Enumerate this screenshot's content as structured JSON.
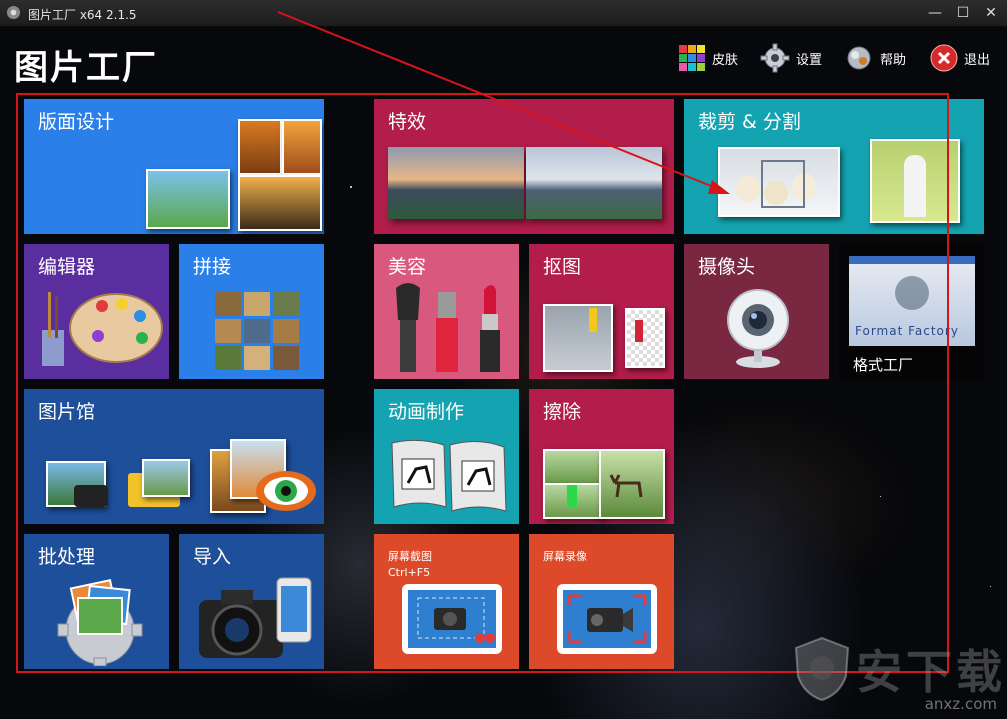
{
  "window": {
    "title": "图片工厂 x64 2.1.5",
    "minimize": "—",
    "maximize": "☐",
    "close": "✕"
  },
  "header": {
    "app_title": "图片工厂",
    "buttons": [
      {
        "label": "皮肤",
        "icon": "palette-grid-icon"
      },
      {
        "label": "设置",
        "icon": "gear-icon"
      },
      {
        "label": "帮助",
        "icon": "help-gear-icon"
      },
      {
        "label": "退出",
        "icon": "exit-icon"
      }
    ]
  },
  "tiles": {
    "layout_design": "版面设计",
    "effects": "特效",
    "crop_split": "裁剪 & 分割",
    "editor": "编辑器",
    "stitch": "拼接",
    "beauty": "美容",
    "cutout": "抠图",
    "camera": "摄像头",
    "format_factory": "格式工厂",
    "format_factory_logo": "Format Factory",
    "gallery": "图片馆",
    "animation": "动画制作",
    "erase": "擦除",
    "batch": "批处理",
    "import": "导入",
    "screenshot": "屏幕截图",
    "screenshot_hotkey": "Ctrl+F5",
    "screen_record": "屏幕录像"
  },
  "colors": {
    "blue": "#2a7fe8",
    "purple": "#5b2ea0",
    "navy": "#1e4f9a",
    "crimson": "#b21d4b",
    "pink": "#d8587e",
    "teal": "#14a3b0",
    "wine": "#7a2841",
    "orange": "#dc4a2a",
    "annotation_red": "#d8141b"
  },
  "watermark": {
    "text": "anxz.com",
    "big": "安下载"
  }
}
